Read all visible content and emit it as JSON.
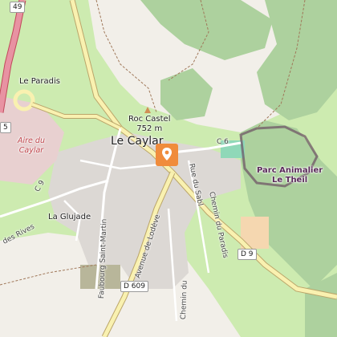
{
  "map": {
    "town": "Le Caylar",
    "peak_name": "Roc Castel",
    "peak_elevation": "752 m",
    "places": {
      "le_paradis": "Le Paradis",
      "la_glujade": "La Glujade"
    },
    "rest_area": {
      "line1": "Aire du",
      "line2": "Caylar"
    },
    "park": {
      "line1": "Parc Animalier",
      "line2": "Le Theil"
    },
    "streets": {
      "rue_du_sabl": "Rue du Sabl",
      "chemin_du_paradis": "Chemin du Paradis",
      "avenue_de_lodeve": "Avenue de Lodève",
      "faubourg": "Faubourg Saint-Martin",
      "chemin_du": "Chemin du",
      "des_rives": "des Rives"
    },
    "shields": {
      "a75": "49",
      "d9": "D 9",
      "d609": "D 609",
      "c6": "C 6",
      "c9": "C 9",
      "left5": "5"
    },
    "colors": {
      "background": "#f2efe9",
      "forest": "#add19e",
      "meadow": "#cdebb0",
      "motorway": "#e892a2",
      "primary_road": "#f9f1b0",
      "built_up": "#dcd8d4",
      "park_boundary": "#6b4f63",
      "marker": "#f08c3c"
    },
    "icons": {
      "marker": "location-pin-icon",
      "peak": "peak-icon"
    }
  }
}
